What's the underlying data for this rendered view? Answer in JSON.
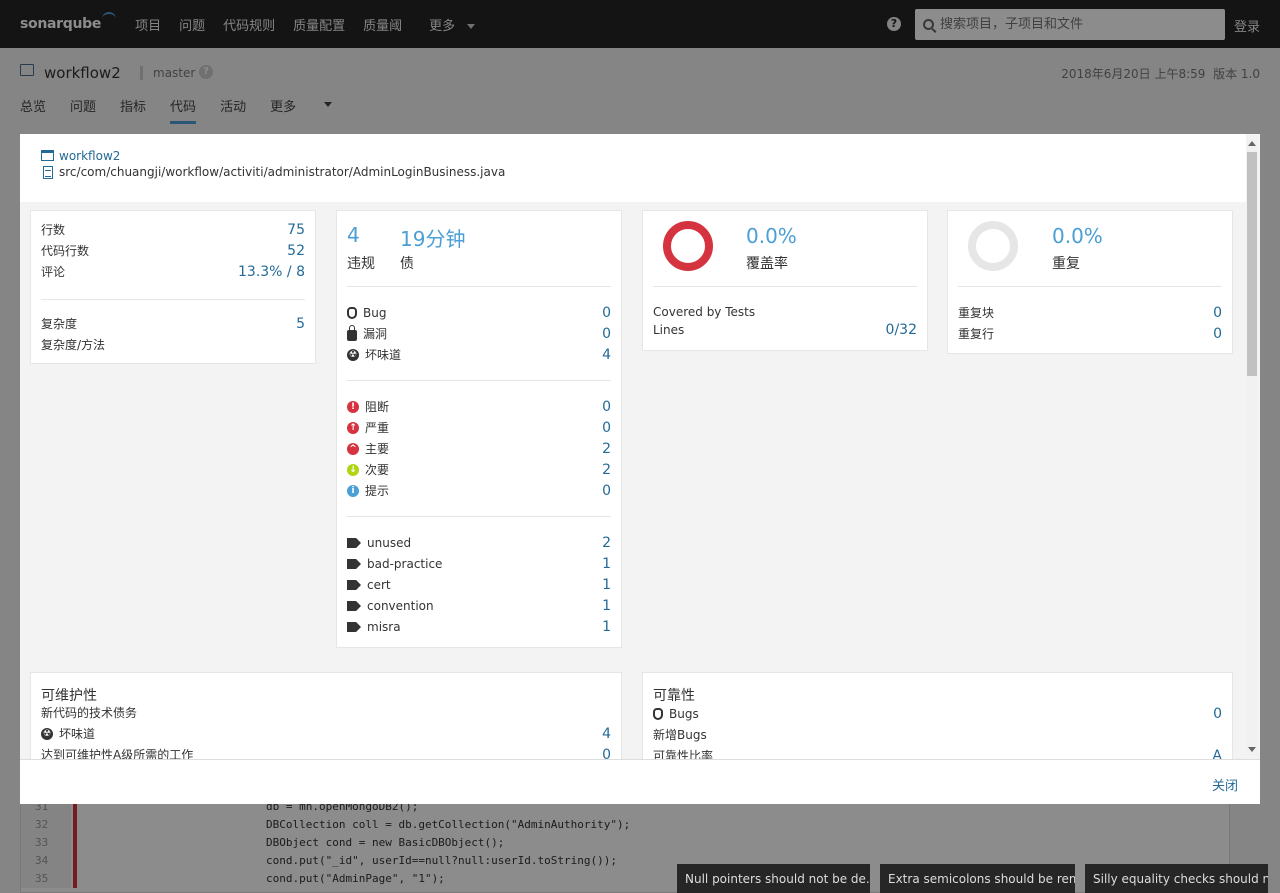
{
  "topnav": {
    "logo": "sonarqube",
    "links": [
      "项目",
      "问题",
      "代码规则",
      "质量配置",
      "质量阈"
    ],
    "more": "更多",
    "help": "?",
    "search_placeholder": "搜索项目，子项目和文件",
    "login": "登录"
  },
  "project": {
    "name": "workflow2",
    "branch": "master",
    "date": "2018年6月20日 上午8:59",
    "version": "版本 1.0",
    "tabs": [
      "总览",
      "问题",
      "指标",
      "代码",
      "活动",
      "更多"
    ]
  },
  "modal": {
    "project_link": "workflow2",
    "file_path": "src/com/chuangji/workflow/activiti/administrator/AdminLoginBusiness.java",
    "close": "关闭",
    "size_card": {
      "lines_label": "行数",
      "lines": "75",
      "ncloc_label": "代码行数",
      "ncloc": "52",
      "comments_label": "评论",
      "comments": "13.3% / 8",
      "complexity_label": "复杂度",
      "complexity": "5",
      "complexity_per_method_label": "复杂度/方法"
    },
    "issues_card": {
      "violations": "4",
      "violations_label": "违规",
      "debt": "19分钟",
      "debt_label": "债",
      "types": [
        {
          "label": "Bug",
          "value": "0",
          "icon": "bug-icon"
        },
        {
          "label": "漏洞",
          "value": "0",
          "icon": "lock-icon"
        },
        {
          "label": "坏味道",
          "value": "4",
          "icon": "code-smell-icon"
        }
      ],
      "severities": [
        {
          "label": "阻断",
          "value": "0",
          "icon": "blocker-icon"
        },
        {
          "label": "严重",
          "value": "0",
          "icon": "critical-icon"
        },
        {
          "label": "主要",
          "value": "2",
          "icon": "major-icon"
        },
        {
          "label": "次要",
          "value": "2",
          "icon": "minor-icon"
        },
        {
          "label": "提示",
          "value": "0",
          "icon": "info-icon"
        }
      ],
      "tags": [
        {
          "label": "unused",
          "value": "2"
        },
        {
          "label": "bad-practice",
          "value": "1"
        },
        {
          "label": "cert",
          "value": "1"
        },
        {
          "label": "convention",
          "value": "1"
        },
        {
          "label": "misra",
          "value": "1"
        }
      ]
    },
    "coverage_card": {
      "value": "0.0%",
      "label": "覆盖率",
      "covered_label": "Covered by Tests",
      "lines_label": "Lines",
      "lines_value": "0/32"
    },
    "duplication_card": {
      "value": "0.0%",
      "label": "重复",
      "blocks_label": "重复块",
      "blocks": "0",
      "lines_label": "重复行",
      "lines": "0"
    },
    "maintainability_card": {
      "title": "可维护性",
      "new_debt_label": "新代码的技术债务",
      "code_smell_label": "坏味道",
      "code_smell": "4",
      "effort_label": "达到可维护性A级所需的工作",
      "effort": "0"
    },
    "reliability_card": {
      "title": "可靠性",
      "bugs_label": "Bugs",
      "bugs": "0",
      "new_bugs_label": "新增Bugs",
      "rating_label": "可靠性比率",
      "rating": "A"
    }
  },
  "code": {
    "lines": [
      {
        "num": "31",
        "text": "db = mn.openMongoDB2();"
      },
      {
        "num": "32",
        "text": "DBCollection coll = db.getCollection(\"AdminAuthority\");"
      },
      {
        "num": "33",
        "text": "DBObject cond = new BasicDBObject();"
      },
      {
        "num": "34",
        "text": "cond.put(\"_id\", userId==null?null:userId.toString());"
      },
      {
        "num": "35",
        "text": "cond.put(\"AdminPage\", \"1\");"
      }
    ]
  },
  "toasts": [
    "Null pointers should not be de...",
    "Extra semicolons should be rem...",
    "Silly equality checks should n..."
  ]
}
